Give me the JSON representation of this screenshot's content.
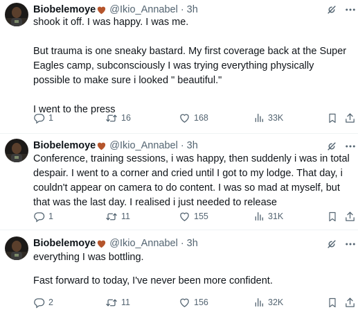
{
  "tweets": [
    {
      "author_name": "Biobelemoye",
      "author_handle": "@Ikio_Annabel",
      "separator": "·",
      "time": "3h",
      "paragraphs": [
        "shook it off. I was happy. I was me.",
        "But trauma is one sneaky bastard. My first coverage back at the Super Eagles camp, subconsciously I was trying everything physically possible to make sure i looked \" beautiful.\"",
        "I went to the press"
      ],
      "replies": "1",
      "reposts": "16",
      "likes": "168",
      "views": "33K"
    },
    {
      "author_name": "Biobelemoye",
      "author_handle": "@Ikio_Annabel",
      "separator": "·",
      "time": "3h",
      "paragraphs": [
        "Conference, training sessions, i was happy, then suddenly i was in total despair. I went to a corner and cried until I got to my lodge. That day, i couldn't appear on camera to do content. I was so mad at myself, but that was the last day. I realised i just needed to release"
      ],
      "replies": "1",
      "reposts": "11",
      "likes": "155",
      "views": "31K"
    },
    {
      "author_name": "Biobelemoye",
      "author_handle": "@Ikio_Annabel",
      "separator": "·",
      "time": "3h",
      "paragraphs": [
        "everything I was bottling.",
        "Fast forward to today, I've never been more confident."
      ],
      "replies": "2",
      "reposts": "11",
      "likes": "156",
      "views": "32K"
    }
  ],
  "icons": {
    "heart_emoji": "brown-heart-icon",
    "grok": "grok-icon",
    "more": "more-icon",
    "reply": "reply-icon",
    "repost": "repost-icon",
    "like": "like-icon",
    "views": "views-icon",
    "bookmark": "bookmark-icon",
    "share": "share-icon"
  },
  "colors": {
    "text": "#0f1419",
    "secondary": "#536471",
    "divider": "#eff3f4",
    "heart": "#b5552c"
  }
}
